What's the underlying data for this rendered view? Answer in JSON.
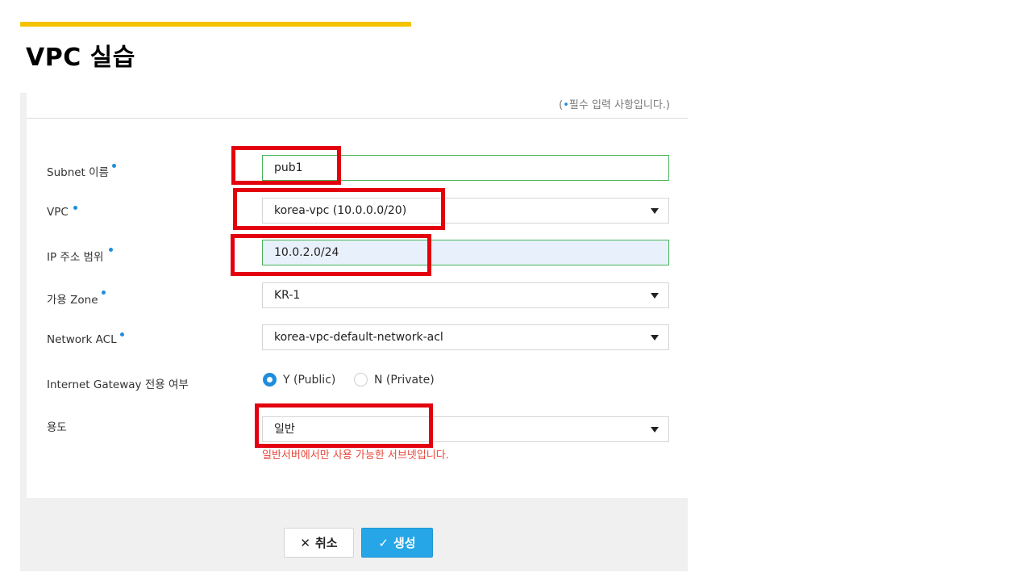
{
  "slide": {
    "title": "VPC 실습"
  },
  "form": {
    "required_note_prefix": "(",
    "required_note_dot": "•",
    "required_note_text": "필수 입력 사항입니다.)",
    "subnet_name": {
      "label": "Subnet 이름",
      "value": "pub1"
    },
    "vpc": {
      "label": "VPC",
      "value": "korea-vpc (10.0.0.0/20)"
    },
    "ip_range": {
      "label": "IP 주소 범위",
      "value": "10.0.2.0/24"
    },
    "zone": {
      "label": "가용 Zone",
      "value": "KR-1"
    },
    "network_acl": {
      "label": "Network ACL",
      "value": "korea-vpc-default-network-acl"
    },
    "igw": {
      "label": "Internet Gateway 전용 여부",
      "option_yes": "Y (Public)",
      "option_no": "N (Private)",
      "selected": "Y (Public)"
    },
    "usage": {
      "label": "용도",
      "value": "일반",
      "warning": "일반서버에서만 사용 가능한 서브넷입니다."
    }
  },
  "buttons": {
    "cancel": "취소",
    "create": "생성"
  },
  "icons": {
    "cancel": "close-icon",
    "create": "check-icon"
  },
  "colors": {
    "accent_bar": "#f5c200",
    "highlight": "#e3000f",
    "primary": "#26a6e6",
    "required_dot": "#1f8ddc",
    "warning": "#e8463a",
    "valid_border": "#49b55a"
  }
}
